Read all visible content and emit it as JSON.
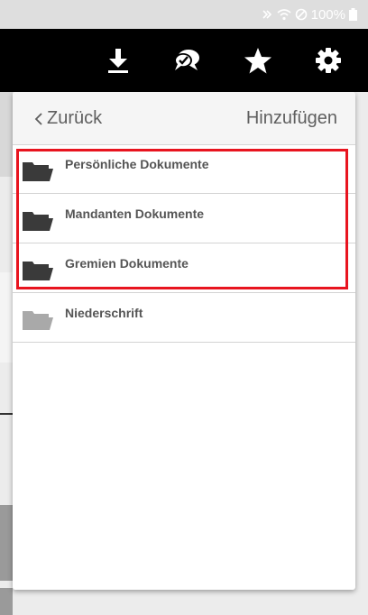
{
  "status_bar": {
    "battery": "100%"
  },
  "toolbar": {
    "buttons": [
      {
        "name": "download-icon"
      },
      {
        "name": "chat-icon"
      },
      {
        "name": "star-icon"
      },
      {
        "name": "gear-icon"
      }
    ]
  },
  "popover": {
    "back_label": "Zurück",
    "add_label": "Hinzufügen",
    "folders": [
      {
        "label": "Persönliche Dokumente",
        "icon": "folder-icon",
        "color": "#3a3a3a"
      },
      {
        "label": "Mandanten Dokumente",
        "icon": "folder-icon",
        "color": "#3a3a3a"
      },
      {
        "label": "Gremien Dokumente",
        "icon": "folder-icon",
        "color": "#3a3a3a"
      },
      {
        "label": "Niederschrift",
        "icon": "folder-icon",
        "color": "#a9a9a9"
      }
    ]
  },
  "highlight": {
    "color": "#e8141f"
  }
}
